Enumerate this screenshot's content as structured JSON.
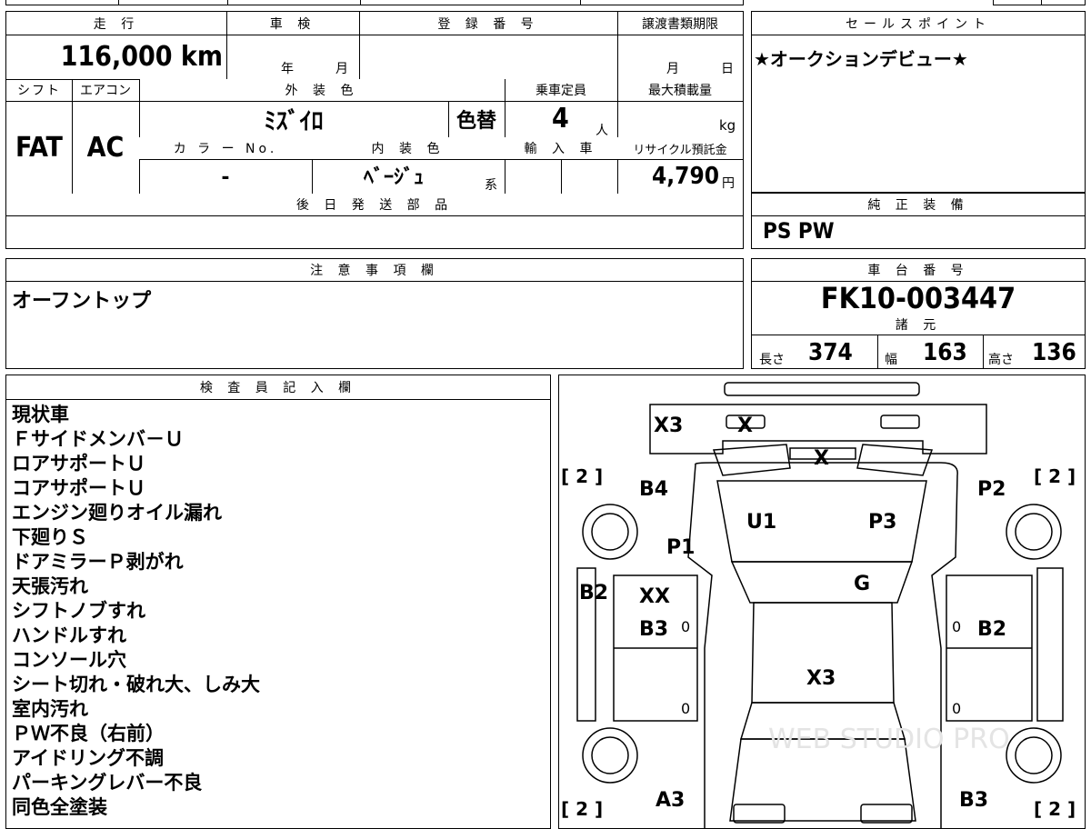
{
  "vehicle": {
    "mileage_label": "走 行",
    "mileage_value": "116,000 km",
    "inspection_label": "車 検",
    "inspection_year": "年",
    "inspection_month": "月",
    "registration_label": "登 録 番 号",
    "deadline_label": "譲渡書類期限",
    "deadline_month": "月",
    "deadline_day": "日",
    "shift_label": "シフト",
    "shift_value": "FAT",
    "ac_label": "エアコン",
    "ac_value": "AC",
    "exterior_color_label": "外 装 色",
    "exterior_color_value": "ﾐｽﾞｲﾛ",
    "repaint_label": "色替",
    "capacity_label": "乗車定員",
    "capacity_value": "4",
    "capacity_unit": "人",
    "max_load_label": "最大積載量",
    "max_load_unit": "kg",
    "color_no_label": "カ ラ ー No.",
    "color_no_value": "-",
    "interior_color_label": "内 装 色",
    "interior_color_value": "ﾍﾞｰｼﾞｭ",
    "interior_color_suffix": "系",
    "import_label": "輸 入 車",
    "recycle_label": "リサイクル預託金",
    "recycle_value": "4,790",
    "recycle_unit": "円",
    "later_parts_label": "後 日 発 送 部 品"
  },
  "sales": {
    "label": "セールスポイント",
    "text": "★オークションデビュー★",
    "genuine_label": "純 正 装 備",
    "genuine_value": "PS PW"
  },
  "notes": {
    "label": "注 意 事 項 欄",
    "text": "オーフントップ"
  },
  "chassis": {
    "label": "車 台 番 号",
    "value": "FK10-003447",
    "spec_label": "諸 元",
    "length_label": "長さ",
    "length_value": "374",
    "width_label": "幅",
    "width_value": "163",
    "height_label": "高さ",
    "height_value": "136"
  },
  "inspector": {
    "label": "検 査 員 記 入 欄",
    "items": [
      "現状車",
      "Ｆサイドメンバ－Ｕ",
      "ロアサポートＵ",
      "コアサポートＵ",
      "エンジン廻りオイル漏れ",
      "下廻りＳ",
      "ドアミラーＰ剥がれ",
      "天張汚れ",
      "シフトノブすれ",
      "ハンドルすれ",
      "コンソール穴",
      "シート切れ・破れ大、しみ大",
      "室内汚れ",
      "ＰＷ不良（右前）",
      "アイドリング不調",
      "パーキングレバー不良",
      "同色全塗装"
    ]
  },
  "diagram": {
    "marks": {
      "x3_front": "X3",
      "x_front": "X",
      "x_hood": "X",
      "b4": "B4",
      "p2": "P2",
      "u1": "U1",
      "p3": "P3",
      "p1": "P1",
      "g": "G",
      "b2_left": "B2",
      "xx": "XX",
      "b3_left": "B3",
      "b2_right": "B2",
      "x3_roof": "X3",
      "a3": "A3",
      "b3_right": "B3",
      "zero": "0"
    },
    "tire_tl": "[ 2 ]",
    "tire_tr": "[ 2 ]",
    "tire_bl": "[ 2 ]",
    "tire_br": "[ 2 ]",
    "watermark": "WEB STUDIO PRO"
  }
}
